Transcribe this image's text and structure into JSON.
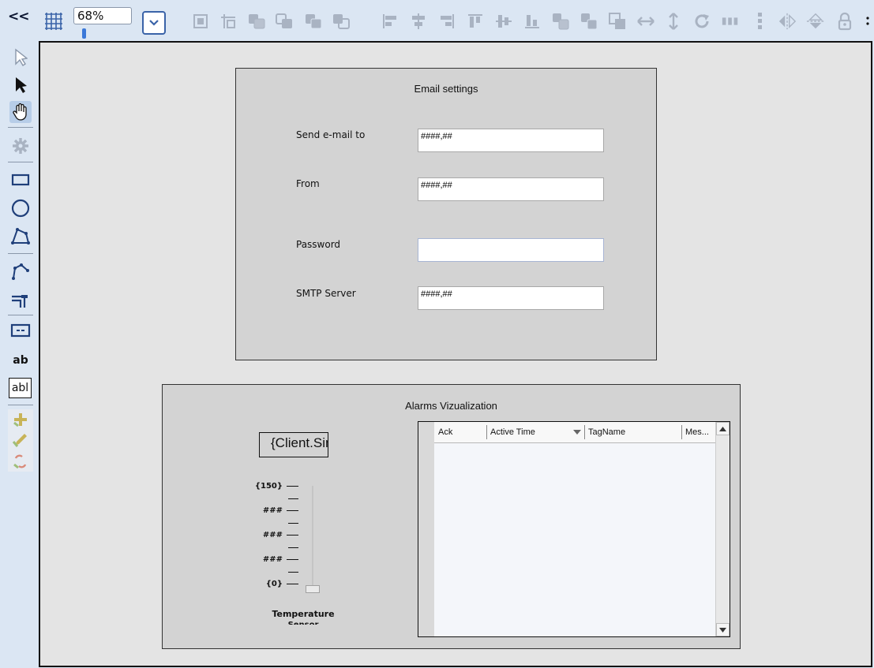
{
  "toolbar": {
    "collapse_label": "<<",
    "zoom_value": "68%",
    "zoom_slider_fraction": 0.05,
    "icons": [
      "size-to-fit-icon",
      "group-icon",
      "bring-to-front-icon",
      "bring-forward-icon",
      "send-backward-icon",
      "send-to-back-icon",
      "align-left-icon",
      "align-center-icon",
      "align-right-icon",
      "align-top-icon",
      "align-middle-icon",
      "align-bottom-icon",
      "same-width-icon",
      "same-height-icon",
      "same-size-icon",
      "space-horizontal-icon",
      "space-vertical-icon",
      "rotate-icon",
      "distribute-horizontal-icon",
      "distribute-vertical-icon",
      "flip-horizontal-icon",
      "flip-vertical-icon",
      "lock-icon"
    ]
  },
  "toolbox": {
    "text_tool_label": "ab",
    "textbox_tool_label": "abl"
  },
  "email_panel": {
    "title": "Email settings",
    "fields": [
      {
        "label": "Send e-mail to",
        "value": "####,##"
      },
      {
        "label": "From",
        "value": "####,##"
      },
      {
        "label": "Password",
        "value": ""
      },
      {
        "label": "SMTP Server",
        "value": "####,##"
      }
    ]
  },
  "alarms_panel": {
    "title": "Alarms Vizualization",
    "client_text": "{Client.Sim",
    "gauge": {
      "labels": [
        "{150}",
        "###",
        "###",
        "###",
        "{0}"
      ],
      "title": "Temperature",
      "subtitle": "Sensor",
      "level_fraction": 0.0
    },
    "grid": {
      "columns": [
        "Ack",
        "Active Time",
        "TagName",
        "Mes..."
      ],
      "sorted_column": "Active Time"
    }
  },
  "colors": {
    "toolbar_bg": "#dbe6f3",
    "canvas_bg": "#e4e4e4",
    "panel_bg": "#d3d3d3",
    "accent": "#3a63a8"
  }
}
